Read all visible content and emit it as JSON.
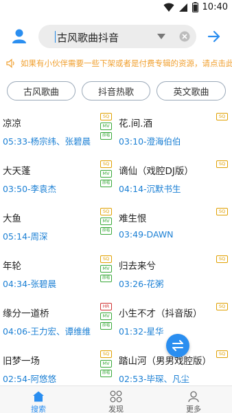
{
  "status_bar": {
    "time": "10:40",
    "battery_level": 0.9
  },
  "search": {
    "query": "古风歌曲抖音"
  },
  "notice": {
    "text": "如果有小伙伴需要一些下架或者是付费专辑的资源，请点击此处"
  },
  "tags": [
    {
      "label": "古风歌曲"
    },
    {
      "label": "抖音热歌"
    },
    {
      "label": "英文歌曲"
    }
  ],
  "songs": [
    {
      "title": "凉凉",
      "time": "05:33",
      "artist": "杨宗纬、张碧晨",
      "badges": [
        "SQ",
        "MV",
        "HQ"
      ]
    },
    {
      "title": "花.间.酒",
      "time": "03:10",
      "artist": "澄海伯伯",
      "badges": [
        "SQ"
      ]
    },
    {
      "title": "大天蓬",
      "time": "03:50",
      "artist": "李袁杰",
      "badges": [
        "SQ",
        "MV",
        "HQ"
      ]
    },
    {
      "title": "谪仙（戏腔DJ版）",
      "time": "04:14",
      "artist": "沉默书生",
      "badges": [
        "SQ"
      ]
    },
    {
      "title": "大鱼",
      "time": "05:14",
      "artist": "周深",
      "badges": [
        "SQ",
        "MV",
        "HQ"
      ]
    },
    {
      "title": "难生恨",
      "time": "03:49",
      "artist": "DAWN",
      "badges": [
        "SQ"
      ]
    },
    {
      "title": "年轮",
      "time": "04:34",
      "artist": "张碧晨",
      "badges": [
        "SQ",
        "MV",
        "HQ"
      ]
    },
    {
      "title": "归去来兮",
      "time": "03:26",
      "artist": "花粥",
      "badges": [
        "SQ"
      ]
    },
    {
      "title": "缘分一道桥",
      "time": "04:06",
      "artist": "王力宏、谭维维",
      "badges": [
        "HR",
        "MV",
        "HQ"
      ]
    },
    {
      "title": "小生不才（抖音版）",
      "time": "01:32",
      "artist": "星华",
      "badges": [
        "SQ"
      ]
    },
    {
      "title": "旧梦一场",
      "time": "02:54",
      "artist": "阿悠悠",
      "badges": [
        "SQ",
        "MV",
        "HQ"
      ]
    },
    {
      "title": "踏山河（男男戏腔版）",
      "time": "02:53",
      "artist": "毕琛、凡尘",
      "badges": [
        "SQ"
      ]
    }
  ],
  "badge_labels": {
    "SQ": "SQ",
    "HR": "HR",
    "MV": "MV",
    "HQ": "原唱"
  },
  "bottom_nav": [
    {
      "label": "搜索",
      "icon": "home-icon",
      "active": true
    },
    {
      "label": "发现",
      "icon": "discover-icon",
      "active": false
    },
    {
      "label": "更多",
      "icon": "more-icon",
      "active": false
    }
  ],
  "colors": {
    "accent": "#2a8ef0",
    "link": "#1a7fd4",
    "notice": "#f0a030"
  }
}
